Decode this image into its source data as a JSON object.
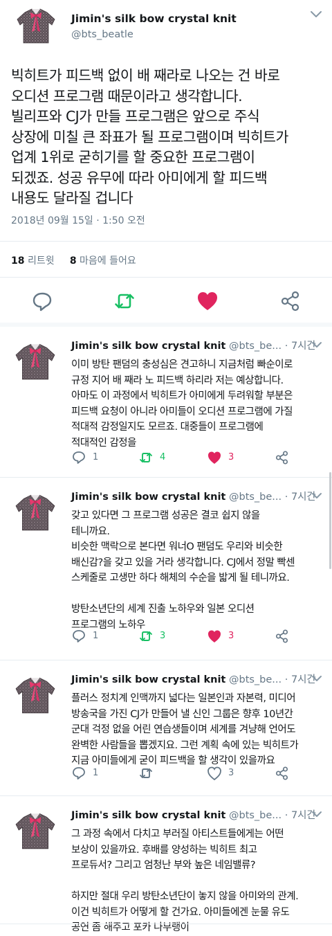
{
  "main_tweet": {
    "display_name": "Jimin's silk bow crystal knit",
    "handle": "@bts_beatle",
    "text": "빅히트가 피드백 없이 배 째라로 나오는 건 바로\n오디션 프로그램 때문이라고 생각합니다.\n빌리프와 CJ가 만들 프로그램은 앞으로 주식\n상장에 미칠 큰 좌표가 될 프로그램이며 빅히트가\n업계 1위로 굳히기를 할 중요한 프로그램이\n되겠죠. 성공 유무에 따라 아미에게 할 피드백\n내용도 달라질 겁니다",
    "timestamp": "2018년 09월 15일 · 1:50 오전",
    "retweet_count": "18",
    "retweet_label": "리트윗",
    "like_count": "8",
    "like_label": "마음에 들어요"
  },
  "colors": {
    "accent": "#1da1f2",
    "retweet_green": "#17bf63",
    "like_red": "#e0245e",
    "muted": "#657786"
  },
  "replies": [
    {
      "display_name": "Jimin's silk bow crystal knit",
      "handle_time": " @bts_be... · 7시간",
      "text": "이미 방탄 팬덤의 충성심은 견고하니 지금처럼 빠순이로\n규정 지어 배 째라 노 피드백 하리라 저는 예상합니다.\n아마도 이 과정에서 빅히트가 아미에게 두려워할 부분은\n피드백 요청이 아니라 아미들이 오디션 프로그램에 가질\n적대적 감정일지도 모르죠. 대중들이 프로그램에\n적대적인 감정을",
      "reply_count": "1",
      "retweet_count": "4",
      "like_count": "3",
      "retweeted": true,
      "liked": true
    },
    {
      "display_name": "Jimin's silk bow crystal knit",
      "handle_time": " @bts_be... · 7시간",
      "text": "갖고 있다면 그 프로그램 성공은 결코 쉽지 않을\n테니까요.\n비슷한 맥락으로 본다면 워너O 팬덤도 우리와 비슷한\n배신감?을 갖고 있을 거라 생각합니다. CJ에서 정말 빡센\n스케줄로 고생만 하다 해체의 수순을 밟게 될 테니까요.\n\n방탄소년단의 세계 진출 노하우와 일본 오디션\n프로그램의 노하우",
      "reply_count": "1",
      "retweet_count": "3",
      "like_count": "3",
      "retweeted": true,
      "liked": true
    },
    {
      "display_name": "Jimin's silk bow crystal knit",
      "handle_time": " @bts_be... · 7시간",
      "text": "플러스 정치계 인맥까지 넓다는 일본인과 자본력, 미디어\n방송국을 가진 CJ가 만들어 낼 신인 그룹은 향후 10년간\n군대 걱정 없을 어린 연습생들이며 세계를 겨냥해 언어도\n완벽한 사람들을 뽑겠지요. 그런 계획 속에 있는 빅히트가\n지금 아미들에게 굳이 피드백을 할 생각이 있을까요",
      "reply_count": "1",
      "retweet_count": "",
      "like_count": "3",
      "retweeted": false,
      "liked": false
    },
    {
      "display_name": "Jimin's silk bow crystal knit",
      "handle_time": " @bts_be... · 7시간",
      "text": "그 과정 속에서 다치고 부러질 아티스트들에게는 어떤\n보상이 있을까요. 후배를 양성하는 빅히트 최고\n프로듀서? 그리고 엄청난 부와 높은 네임밸류?\n\n하지만 절대 우리 방탄소년단이 놓지 않을 아미와의 관계.\n이건 빅히트가 어떻게 할 건가요. 아미들에겐 눈물 유도\n공연 좀 해주고 포카 나부랭이",
      "reply_count": "",
      "retweet_count": "",
      "like_count": "",
      "retweeted": false,
      "liked": false
    }
  ]
}
